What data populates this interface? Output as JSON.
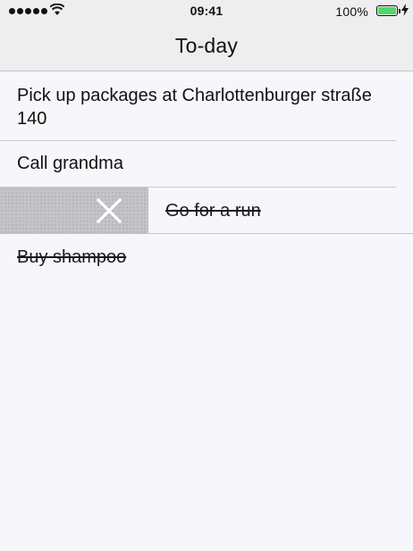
{
  "status_bar": {
    "time": "09:41",
    "battery_percent": "100%",
    "battery_color": "#4cd964"
  },
  "nav": {
    "title": "To-day"
  },
  "todos": [
    {
      "text": "Pick up packages at Charlottenburger straße 140",
      "completed": false
    },
    {
      "text": "Call grandma",
      "completed": false
    },
    {
      "text": "Go for a run",
      "completed": true,
      "swiped": true
    },
    {
      "text": "Buy shampoo",
      "completed": true
    }
  ],
  "swipe_action": {
    "icon": "close-icon",
    "color": "#c4c4c8"
  }
}
